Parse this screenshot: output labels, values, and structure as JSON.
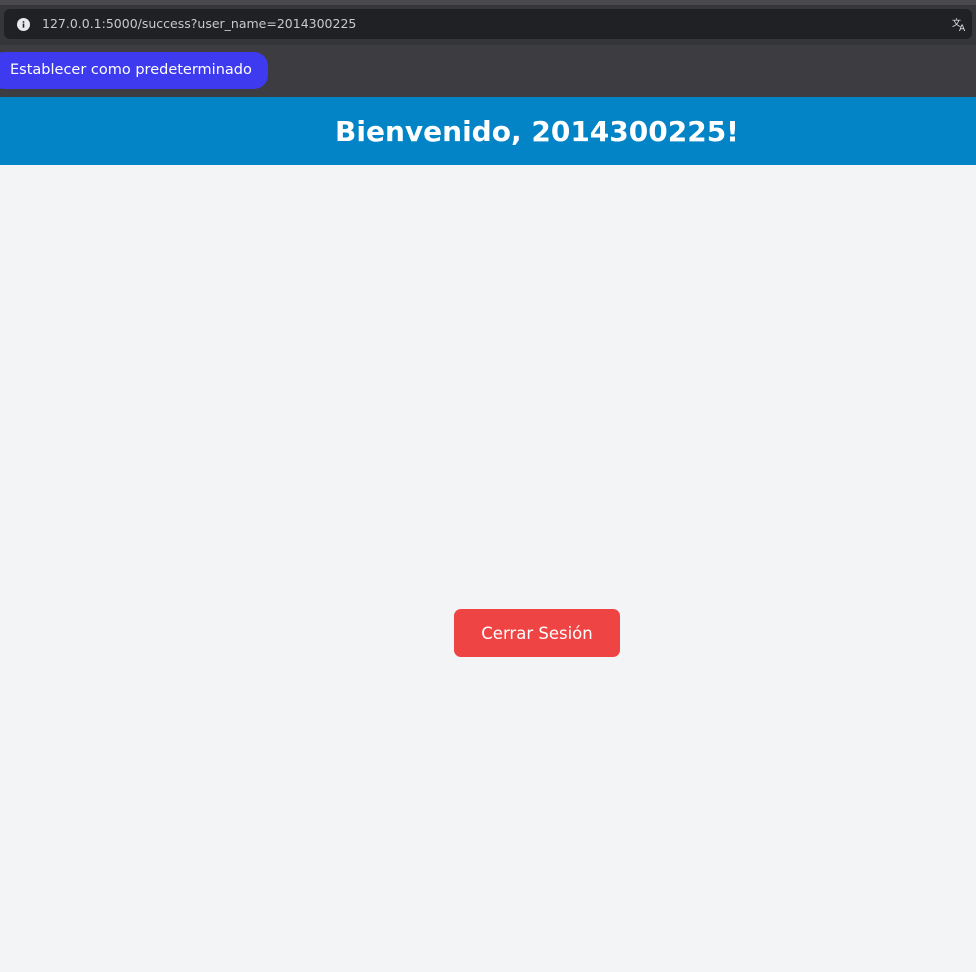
{
  "browser": {
    "url": "127.0.0.1:5000/success?user_name=2014300225",
    "info_icon": "info-icon",
    "translate_icon": "translate-icon"
  },
  "default_prompt": {
    "button_label": "Establecer como predeterminado",
    "color": "#3d3af0"
  },
  "header": {
    "title": "Bienvenido, 2014300225!",
    "color": "#0284c7"
  },
  "main": {
    "logout_label": "Cerrar Sesión",
    "logout_color": "#ef4444"
  }
}
